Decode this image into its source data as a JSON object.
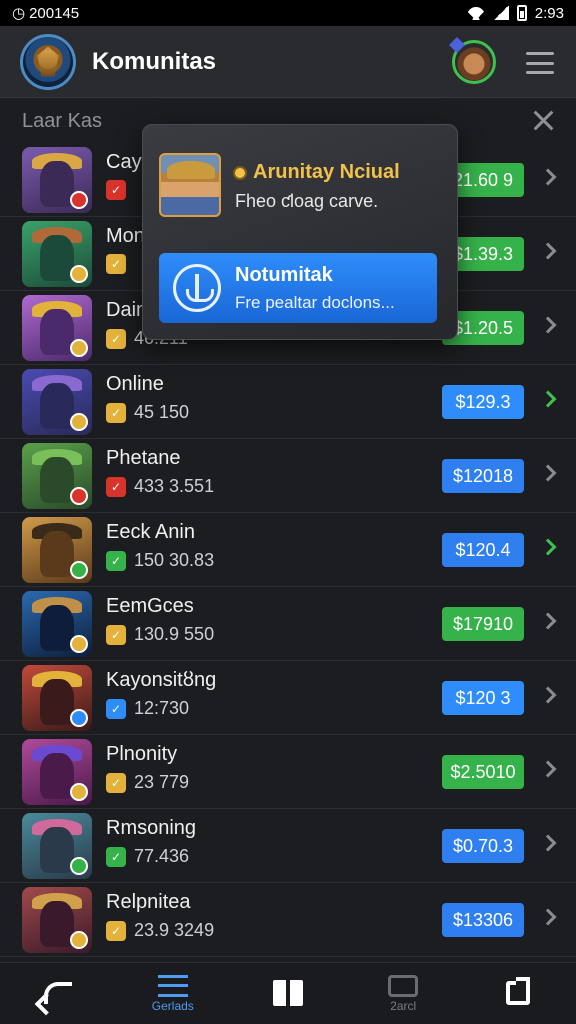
{
  "status_bar": {
    "left_text": "200145",
    "time": "2:93"
  },
  "app_bar": {
    "title": "Komunitas"
  },
  "section": {
    "title": "Laar Kas"
  },
  "popup": {
    "title": "Arunitay Nciual",
    "subtitle": "Fheo ƈloag carve.",
    "notification": {
      "title": "Notumitak",
      "subtitle": "Fre pealtar doclons..."
    }
  },
  "items": [
    {
      "name": "Cay",
      "stat": "",
      "badge_color": "#d9342b",
      "price": "21.60 9",
      "price_color": "#36b24a",
      "active": false,
      "thumb": [
        "#7a5bb0",
        "#3b2a55",
        "#d9a743"
      ]
    },
    {
      "name": "Mon",
      "stat": "",
      "badge_color": "#e2b23a",
      "price": "$1.39.3",
      "price_color": "#36b24a",
      "active": false,
      "thumb": [
        "#3aa36a",
        "#1c4a3a",
        "#b06a3a"
      ]
    },
    {
      "name": "Dain",
      "stat": "46.211",
      "badge_color": "#e2b23a",
      "price": "$1.20.5",
      "price_color": "#36b24a",
      "active": false,
      "thumb": [
        "#b06ad0",
        "#4a2a6a",
        "#e2b23a"
      ]
    },
    {
      "name": "Online",
      "stat": "45 150",
      "badge_color": "#e2b23a",
      "price": "$129.3",
      "price_color": "#2f8dfb",
      "active": true,
      "thumb": [
        "#4a4ab0",
        "#2a2a5a",
        "#8a6ad0"
      ]
    },
    {
      "name": "Phetane",
      "stat": "433 3.551",
      "badge_color": "#d9342b",
      "price": "$12018",
      "price_color": "#2f7ff0",
      "active": false,
      "thumb": [
        "#5aa04a",
        "#2a4a2a",
        "#7ac05a"
      ]
    },
    {
      "name": "Eeck Anin",
      "stat": "150 30.83",
      "badge_color": "#36b24a",
      "price": "$120.4",
      "price_color": "#2f7ff0",
      "active": true,
      "thumb": [
        "#d09a4a",
        "#5a3a1a",
        "#3a2a1a"
      ]
    },
    {
      "name": "EemGces",
      "stat": "130.9 550",
      "badge_color": "#e2b23a",
      "price": "$17910",
      "price_color": "#36b24a",
      "active": false,
      "thumb": [
        "#2a6ab0",
        "#0e1e3a",
        "#c0904a"
      ]
    },
    {
      "name": "Kayonsitȣng",
      "stat": "12:730",
      "badge_color": "#2f8dfb",
      "price": "$120 3",
      "price_color": "#2f8dfb",
      "active": false,
      "thumb": [
        "#c04a3a",
        "#3a1a1a",
        "#e2b23a"
      ]
    },
    {
      "name": "Plnonity",
      "stat": "23 779",
      "badge_color": "#e2b23a",
      "price": "$2.5010",
      "price_color": "#36b24a",
      "active": false,
      "thumb": [
        "#b04a9a",
        "#4a1a4a",
        "#6a4ad0"
      ]
    },
    {
      "name": "Rmsoning",
      "stat": "77.436",
      "badge_color": "#36b24a",
      "price": "$0.70.3",
      "price_color": "#2f7ff0",
      "active": false,
      "thumb": [
        "#4a8a9a",
        "#2a3a4a",
        "#d06a9a"
      ]
    },
    {
      "name": "Relpnitea",
      "stat": "23.9 3249",
      "badge_color": "#e2b23a",
      "price": "$13306",
      "price_color": "#2f7ff0",
      "active": false,
      "thumb": [
        "#a04a4a",
        "#3a1a2a",
        "#d0a04a"
      ]
    }
  ],
  "bottom_nav": [
    {
      "label": "",
      "icon": "back-icon",
      "active": false
    },
    {
      "label": "Gerlads",
      "icon": "games-icon",
      "active": true
    },
    {
      "label": "",
      "icon": "book-icon",
      "active": false
    },
    {
      "label": "2arcl",
      "icon": "store-icon",
      "active": false
    },
    {
      "label": "",
      "icon": "share-icon",
      "active": false
    }
  ],
  "colors": {
    "accent_blue": "#2f8dfb",
    "accent_green": "#3ec14e",
    "gold": "#f2c14a"
  }
}
